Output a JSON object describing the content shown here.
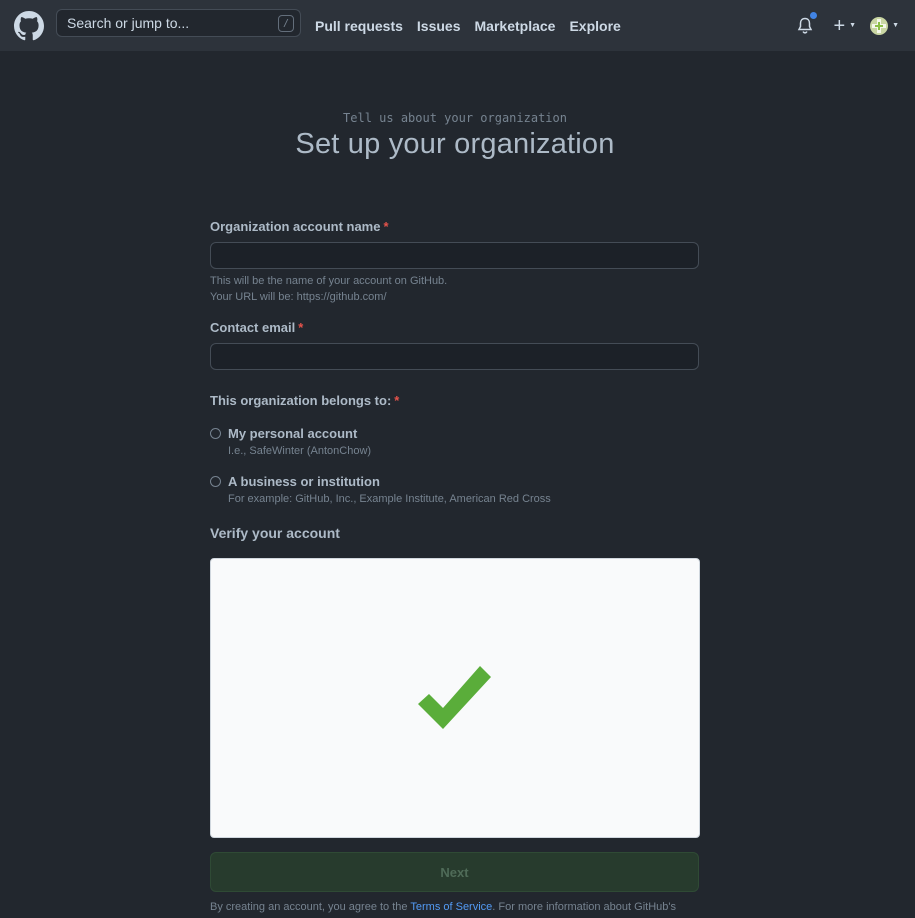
{
  "header": {
    "search_placeholder": "Search or jump to...",
    "search_shortcut": "/",
    "nav": [
      "Pull requests",
      "Issues",
      "Marketplace",
      "Explore"
    ]
  },
  "page": {
    "eyebrow": "Tell us about your organization",
    "title": "Set up your organization"
  },
  "form": {
    "org_name_label": "Organization account name",
    "org_name_value": "",
    "org_name_note_1": "This will be the name of your account on GitHub.",
    "org_name_note_2": "Your URL will be: https://github.com/",
    "email_label": "Contact email",
    "email_value": "",
    "required_marker": "*",
    "belongs_label": "This organization belongs to:",
    "options": [
      {
        "title": "My personal account",
        "subtitle": "I.e., SafeWinter (AntonChow)"
      },
      {
        "title": "A business or institution",
        "subtitle": "For example: GitHub, Inc., Example Institute, American Red Cross"
      }
    ],
    "verify_label": "Verify your account",
    "next_label": "Next"
  },
  "legal": {
    "prefix": "By creating an account, you agree to the ",
    "link": "Terms of Service",
    "suffix": ". For more information about GitHub's"
  },
  "colors": {
    "header_bg": "#2d333b",
    "page_bg": "#22272e",
    "required": "#e5534b",
    "link": "#539bf5",
    "check_green": "#5aad3a",
    "notification_dot": "#4184e4"
  }
}
